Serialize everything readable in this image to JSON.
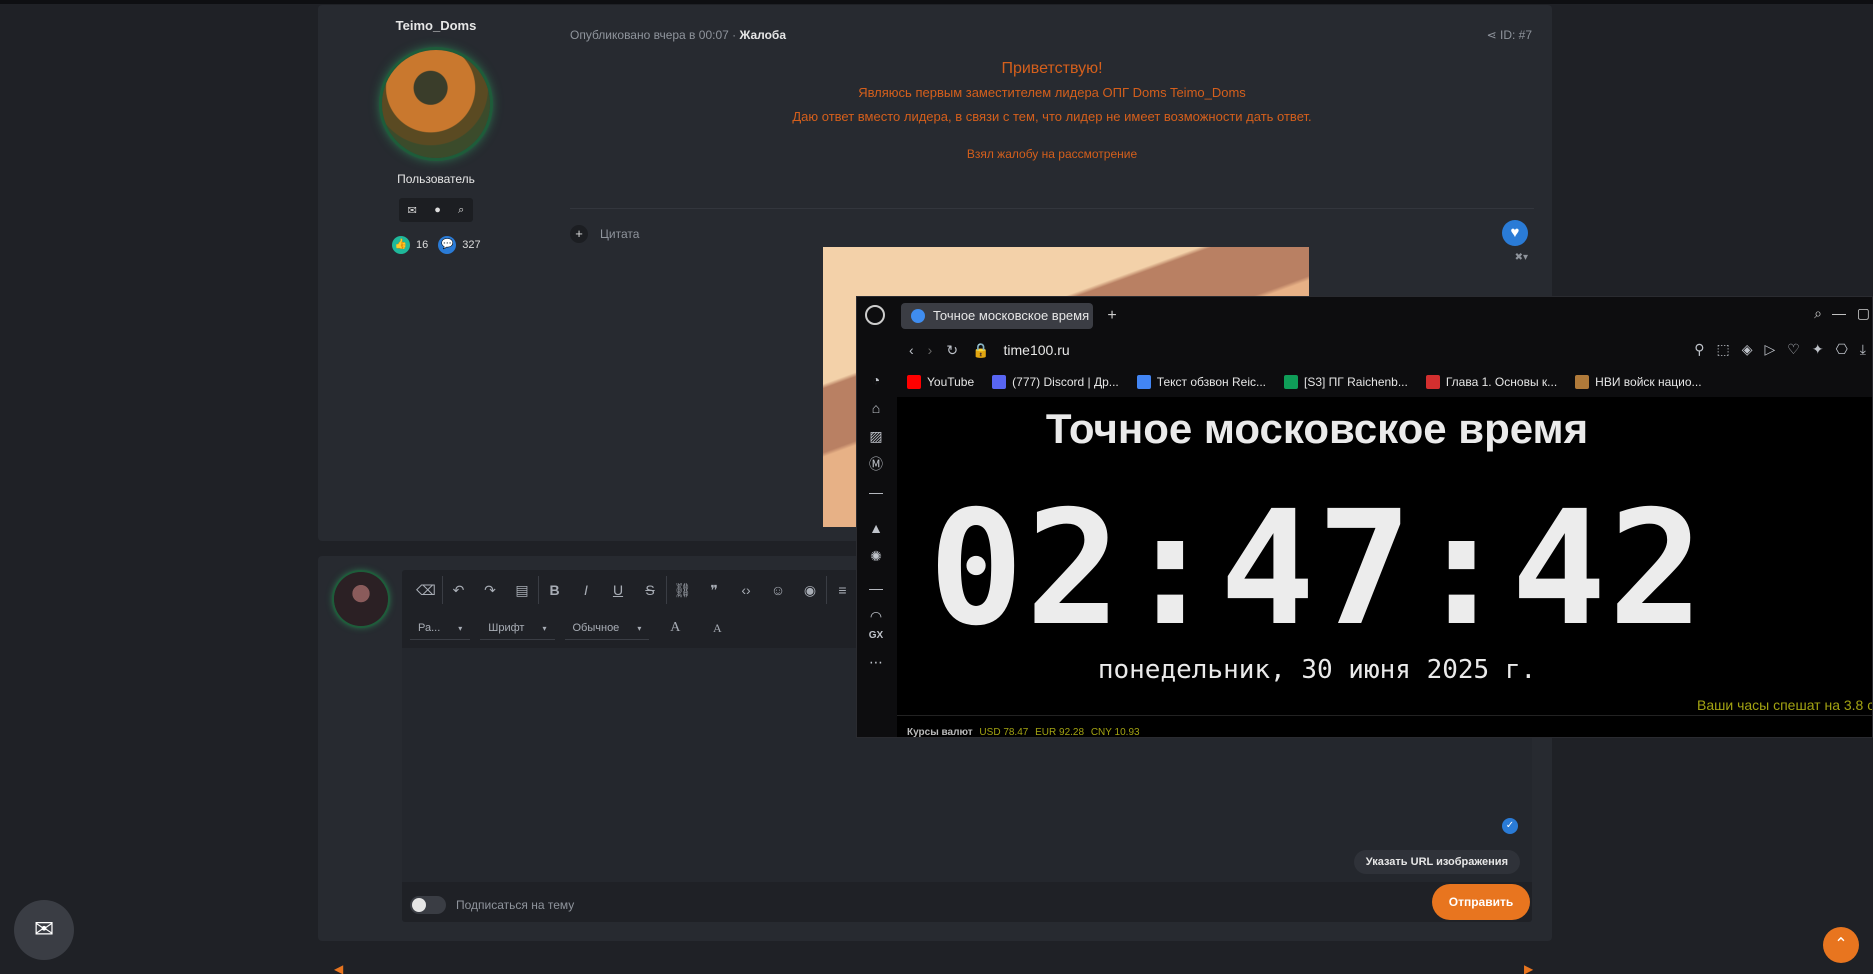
{
  "post": {
    "author_name": "Teimo_Doms",
    "role": "Пользователь",
    "likes": "16",
    "messages": "327",
    "meta_prefix": "Опубликовано вчера в 00:07 · ",
    "meta_tag": "Жалоба",
    "id_label": "ID: #7",
    "body": {
      "line1": "Приветствую!",
      "line2": "Являюсь первым заместителем лидера ОПГ Doms Teimo_Doms",
      "line3": "Даю ответ вместо лидера, в связи с тем, что лидер не имеет возможности дать ответ.",
      "line4": "Взял жалобу на рассмотрение"
    },
    "quote_label": "Цитата"
  },
  "reply": {
    "dropdown_size": "Ра...",
    "dropdown_font": "Шрифт",
    "dropdown_style": "Обычное",
    "url_button": "Указать URL изображения",
    "subscribe_label": "Подписаться на тему",
    "send_button": "Отправить"
  },
  "browser": {
    "tab_title": "Точное московское время",
    "url": "time100.ru",
    "bookmarks": [
      {
        "label": "YouTube",
        "color": "#ff0000"
      },
      {
        "label": "(777) Discord | Др...",
        "color": "#5865f2"
      },
      {
        "label": "Текст обзвон Reic...",
        "color": "#4285f4"
      },
      {
        "label": "[S3] ПГ Raichenb...",
        "color": "#0f9d58"
      },
      {
        "label": "Глава 1. Основы к...",
        "color": "#d32f2f"
      },
      {
        "label": "НВИ войск нацио...",
        "color": "#b07a3a"
      }
    ],
    "page": {
      "title": "Точное московское время",
      "time": "02:47:42",
      "date": "понедельник, 30 июня 2025 г.",
      "note": "Ваши часы спешат на 3.8 с",
      "rates_label": "Курсы валют",
      "rate_usd": "USD 78.47",
      "rate_eur": "EUR 92.28",
      "rate_cny": "CNY 10.93"
    }
  },
  "colors": {
    "accent": "#e8751f",
    "post_text": "#d45f1c",
    "like": "#2a7bd6"
  }
}
